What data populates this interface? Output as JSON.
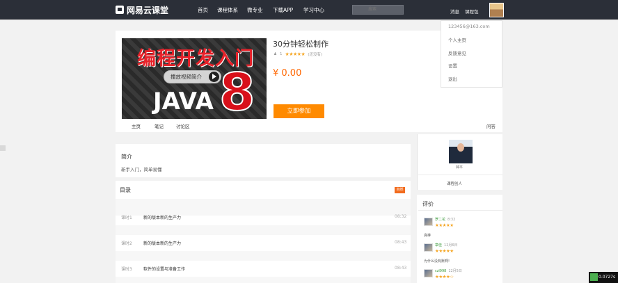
{
  "nav": {
    "logo": "网易云课堂",
    "items": [
      "首页",
      "课程体系",
      "微专业",
      "下载APP",
      "学习中心"
    ],
    "search_placeholder": "搜索",
    "messages": "消息",
    "course_pack": "课程包"
  },
  "user_menu": {
    "email": "123456@163.com",
    "items": [
      "个人主页",
      "反馈意见",
      "设置",
      "退出"
    ]
  },
  "course": {
    "cover_title": "编程开发入门",
    "cover_java": "JAVA",
    "cover_number": "8",
    "play_label": "播放视频简介",
    "name": "30分钟轻松制作",
    "learners": "1",
    "stars": "★★★★★",
    "rating_note": "(还没有)",
    "price": "¥ 0.00",
    "join_label": "立即参加"
  },
  "tabs": [
    "主页",
    "笔记",
    "讨论区"
  ],
  "qa_label": "问答",
  "intro": {
    "title": "简介",
    "text": "新手入门，简单易懂"
  },
  "toc": {
    "title": "目录",
    "badge": "自然",
    "lessons": [
      {
        "num": "课时1",
        "name": "新的版本新的生产力",
        "time": "08:32"
      },
      {
        "num": "课时2",
        "name": "新的版本新的生产力",
        "time": "08:43"
      },
      {
        "num": "课时3",
        "name": "软件的设置与准备工作",
        "time": "08:43"
      }
    ]
  },
  "teacher": {
    "name": "钟平",
    "role": "课程创人"
  },
  "reviews": {
    "title": "评价",
    "items": [
      {
        "user": "罗二花",
        "date": "8:32",
        "stars": "★★★★★",
        "text": "真棒"
      },
      {
        "user": "章佳",
        "date": "12月6日",
        "stars": "★★★★★",
        "text": "为什么没有账啊!"
      },
      {
        "user": "czl998",
        "date": "12月5日",
        "stars": "★★★★☆",
        "text": ""
      }
    ]
  },
  "fps": "0.0727s"
}
